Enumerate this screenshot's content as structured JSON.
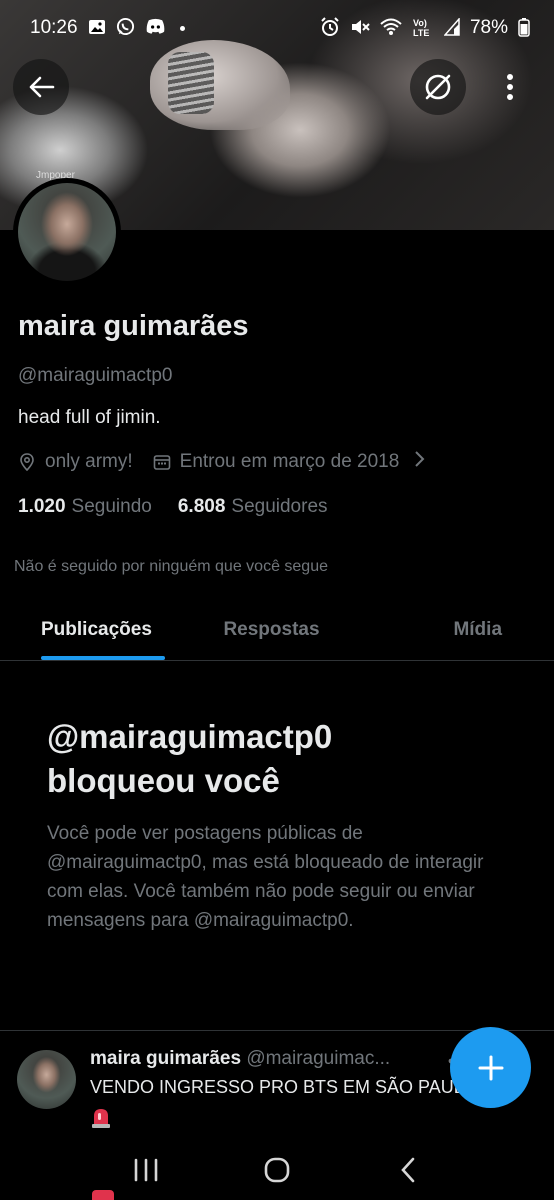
{
  "status_bar": {
    "time": "10:26",
    "battery": "78%",
    "left_icons": [
      "image-icon",
      "whatsapp-icon",
      "discord-icon",
      "dot-icon"
    ],
    "right_icons": [
      "alarm-icon",
      "mute-icon",
      "wifi-icon",
      "volte-icon",
      "signal-icon"
    ]
  },
  "banner": {
    "caption": "Jmpoper"
  },
  "profile": {
    "display_name": "maira guimarães",
    "handle": "@mairaguimactp0",
    "bio": "head full of jimin.",
    "location": "only army!",
    "joined": "Entrou em março de 2018",
    "following_count": "1.020",
    "following_label": "Seguindo",
    "followers_count": "6.808",
    "followers_label": "Seguidores",
    "not_followed_text": "Não é seguido por ninguém que você segue"
  },
  "tabs": [
    {
      "label": "Publicações",
      "active": true
    },
    {
      "label": "Respostas",
      "active": false
    },
    {
      "label": "Mídia",
      "active": false
    }
  ],
  "blocked": {
    "title": "@mairaguimactp0 bloqueou você",
    "body": "Você pode ver postagens públicas de @mairaguimactp0, mas está bloqueado de interagir com elas. Você também não pode seguir ou enviar mensagens para @mairaguimactp0."
  },
  "tweet": {
    "name": "maira guimarães",
    "handle": "@mairaguimac...",
    "text": "VENDO INGRESSO PRO BTS EM SÃO PAULO",
    "emoji": "🚨"
  },
  "fab": {
    "label": "+"
  },
  "colors": {
    "accent": "#1d9bf0",
    "background": "#000000",
    "text_primary": "#e7e9ea",
    "text_secondary": "#71767b",
    "divider": "#2f3336"
  }
}
